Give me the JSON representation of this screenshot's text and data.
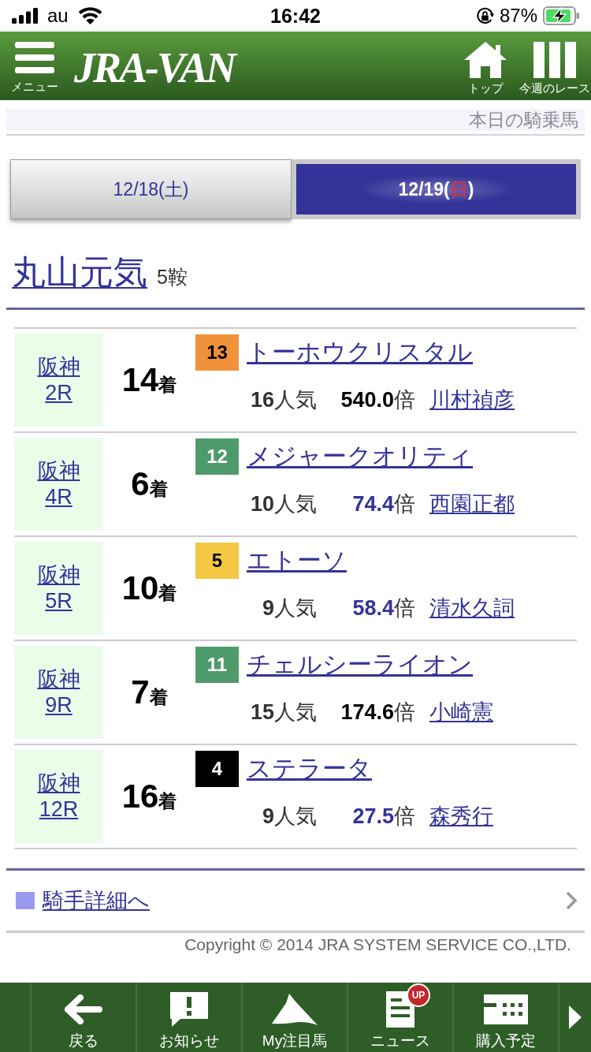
{
  "status_bar": {
    "carrier": "au",
    "time": "16:42",
    "battery": "87%"
  },
  "header": {
    "menu_label": "メニュー",
    "logo": "JRA-VAN",
    "nav": [
      {
        "kind": "home",
        "label": "トップ"
      },
      {
        "kind": "races",
        "label": "今週のレース"
      }
    ]
  },
  "page_title": "本日の騎乗馬",
  "date_tabs": [
    {
      "date": "12/18(",
      "weekday": "土",
      "close": ")",
      "sunday": false,
      "selected": false
    },
    {
      "date": "12/19(",
      "weekday": "日",
      "close": ")",
      "sunday": true,
      "selected": true
    }
  ],
  "jockey": {
    "name": "丸山元気",
    "rides": "5鞍"
  },
  "rides": [
    {
      "venue": "阪神",
      "race": "2R",
      "place": "14",
      "place_unit": "着",
      "horse_number": "13",
      "color": "#f0923a",
      "horse": "トーホウクリスタル",
      "popularity": "16",
      "popularity_unit": "人気",
      "odds": {
        "value": "540.0",
        "unit": "倍",
        "color": "#000000"
      },
      "trainer": "川村禎彦"
    },
    {
      "venue": "阪神",
      "race": "4R",
      "place": "6",
      "place_unit": "着",
      "horse_number": "12",
      "color": "#4f9a6b",
      "horse": "メジャークオリティ",
      "popularity": "10",
      "popularity_unit": "人気",
      "odds": {
        "value": "74.4",
        "unit": "倍",
        "color": "#333399"
      },
      "trainer": "西園正都"
    },
    {
      "venue": "阪神",
      "race": "5R",
      "place": "10",
      "place_unit": "着",
      "horse_number": "5",
      "color": "#f5c843",
      "horse": "エトーソ",
      "popularity": "9",
      "popularity_unit": "人気",
      "odds": {
        "value": "58.4",
        "unit": "倍",
        "color": "#333399"
      },
      "trainer": "清水久詞"
    },
    {
      "venue": "阪神",
      "race": "9R",
      "place": "7",
      "place_unit": "着",
      "horse_number": "11",
      "color": "#4f9a6b",
      "horse": "チェルシーライオン",
      "popularity": "15",
      "popularity_unit": "人気",
      "odds": {
        "value": "174.6",
        "unit": "倍",
        "color": "#000000"
      },
      "trainer": "小崎憲"
    },
    {
      "venue": "阪神",
      "race": "12R",
      "place": "16",
      "place_unit": "着",
      "horse_number": "4",
      "color": "#000000",
      "horse": "ステラータ",
      "popularity": "9",
      "popularity_unit": "人気",
      "odds": {
        "value": "27.5",
        "unit": "倍",
        "color": "#333399"
      },
      "trainer": "森秀行"
    }
  ],
  "detail_link": "騎手詳細へ",
  "copyright": "Copyright © 2014 JRA SYSTEM SERVICE CO.,LTD.",
  "tab_bar": {
    "items": [
      {
        "kind": "back",
        "label": "戻る"
      },
      {
        "kind": "notice",
        "label": "お知らせ"
      },
      {
        "kind": "horse",
        "label": "My注目馬"
      },
      {
        "kind": "news",
        "label": "ニュース",
        "badge": "UP"
      },
      {
        "kind": "schedule",
        "label": "購入予定"
      }
    ]
  }
}
